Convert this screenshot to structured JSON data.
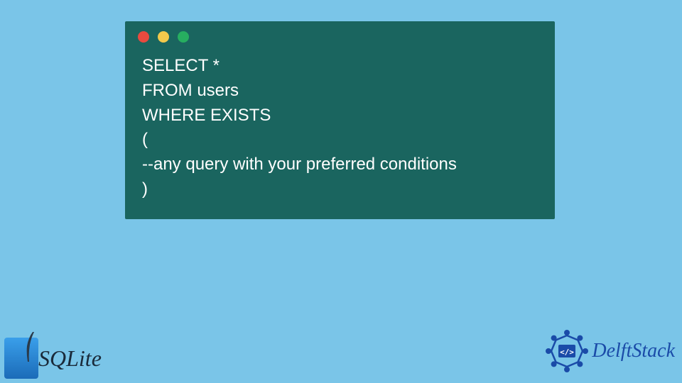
{
  "code": {
    "line1": "SELECT *",
    "line2": "FROM users",
    "line3": "WHERE EXISTS",
    "line4": "(",
    "line5": "--any query with your preferred conditions",
    "line6": ")"
  },
  "logos": {
    "sqlite": "SQLite",
    "delftstack": "DelftStack"
  },
  "colors": {
    "background": "#7ac5e8",
    "codeWindow": "#1a655f",
    "trafficRed": "#e84a3f",
    "trafficYellow": "#f2c94c",
    "trafficGreen": "#27ae60"
  }
}
